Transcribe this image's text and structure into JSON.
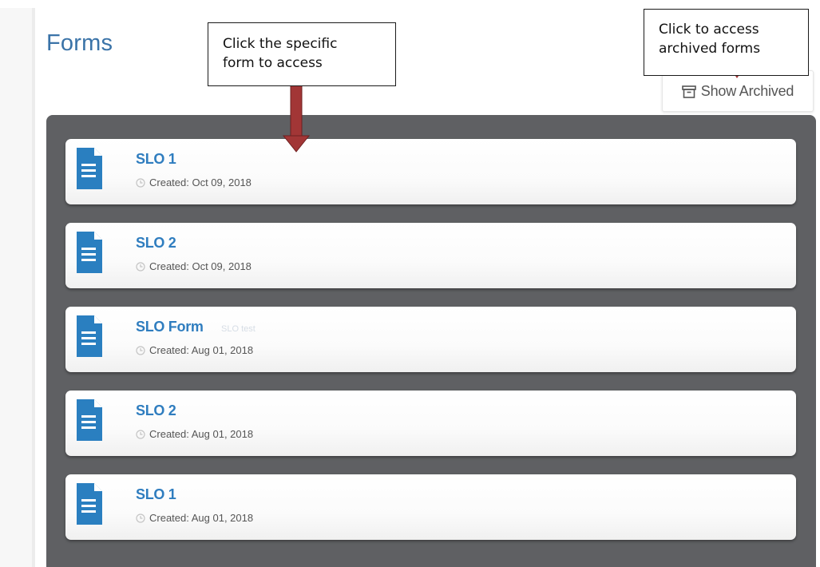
{
  "page": {
    "title": "Forms"
  },
  "toolbar": {
    "show_archived_label": "Show Archived",
    "archive_icon": "archive-box-icon"
  },
  "forms": [
    {
      "title": "SLO 1",
      "created": "Created: Oct 09, 2018",
      "icon": "document-icon"
    },
    {
      "title": "SLO 2",
      "created": "Created: Oct 09, 2018",
      "icon": "document-icon"
    },
    {
      "title": "SLO Form",
      "created": "Created: Aug 01, 2018",
      "icon": "document-icon",
      "faint_text": "SLO test"
    },
    {
      "title": "SLO 2",
      "created": "Created: Aug 01, 2018",
      "icon": "document-icon"
    },
    {
      "title": "SLO 1",
      "created": "Created: Aug 01, 2018",
      "icon": "document-icon"
    }
  ],
  "annotations": {
    "form_callout": {
      "line1": "Click the specific",
      "line2": "form to access"
    },
    "archived_callout": {
      "line1": "Click to access",
      "line2": "archived forms"
    }
  },
  "colors": {
    "title_blue": "#3a73a8",
    "form_link_blue": "#2f7dbf",
    "doc_icon_blue": "#2a7fc0",
    "panel_gray": "#5f6063",
    "arrow_red": "#a23636"
  }
}
